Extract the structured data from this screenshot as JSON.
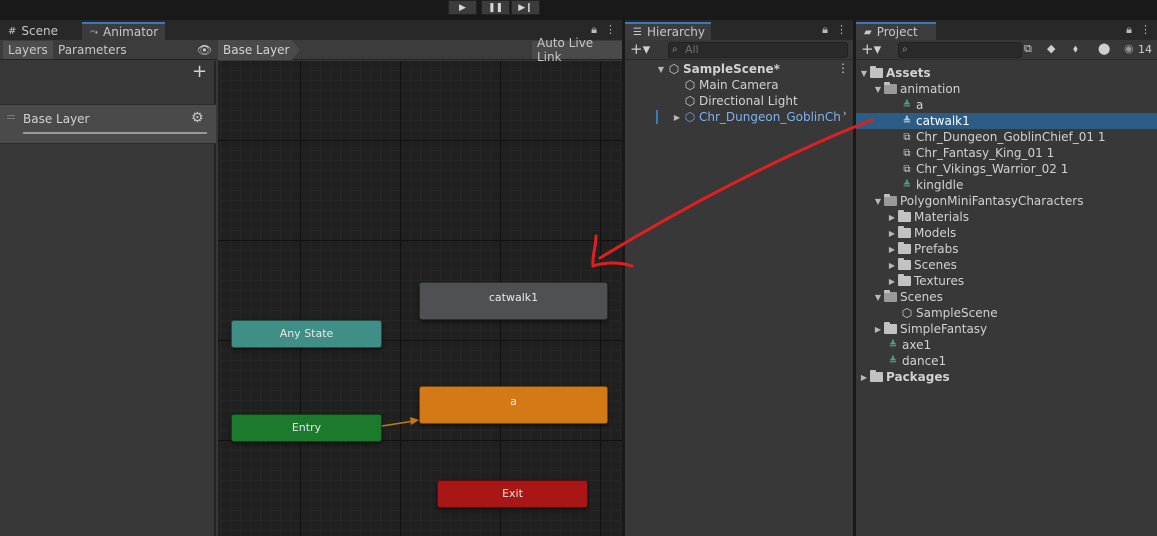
{
  "toolbar": {
    "play_icon": "play-icon",
    "pause_icon": "pause-icon",
    "step_icon": "step-icon"
  },
  "tabs": {
    "scene": "Scene",
    "animator": "Animator",
    "hierarchy": "Hierarchy",
    "project": "Project"
  },
  "animator": {
    "subtabs": {
      "layers": "Layers",
      "parameters": "Parameters"
    },
    "breadcrumb": "Base Layer",
    "auto_live_link": "Auto Live Link",
    "layer": {
      "name": "Base Layer"
    },
    "states": {
      "catwalk": "catwalk1",
      "any_state": "Any State",
      "a": "a",
      "entry": "Entry",
      "exit": "Exit"
    },
    "colors": {
      "default_state": "#4f5054",
      "any_state": "#3f8f86",
      "a_state": "#d37a16",
      "entry": "#1b7a2c",
      "exit": "#a81616"
    }
  },
  "hierarchy": {
    "search_placeholder": "All",
    "scene": "SampleScene*",
    "items": [
      "Main Camera",
      "Directional Light",
      "Chr_Dungeon_GoblinCh"
    ]
  },
  "project": {
    "badge_count": "14",
    "tree": {
      "assets": "Assets",
      "animation": "animation",
      "anim_items": [
        "a",
        "catwalk1",
        "Chr_Dungeon_GoblinChief_01 1",
        "Chr_Fantasy_King_01 1",
        "Chr_Vikings_Warrior_02 1",
        "kingIdle"
      ],
      "polygon": "PolygonMiniFantasyCharacters",
      "polygon_items": [
        "Materials",
        "Models",
        "Prefabs",
        "Scenes",
        "Textures"
      ],
      "scenes": "Scenes",
      "sample_scene": "SampleScene",
      "simple_fantasy": "SimpleFantasy",
      "axe1": "axe1",
      "dance1": "dance1",
      "packages": "Packages"
    },
    "selected": "catwalk1"
  },
  "annotation": {
    "color": "#e02020"
  }
}
